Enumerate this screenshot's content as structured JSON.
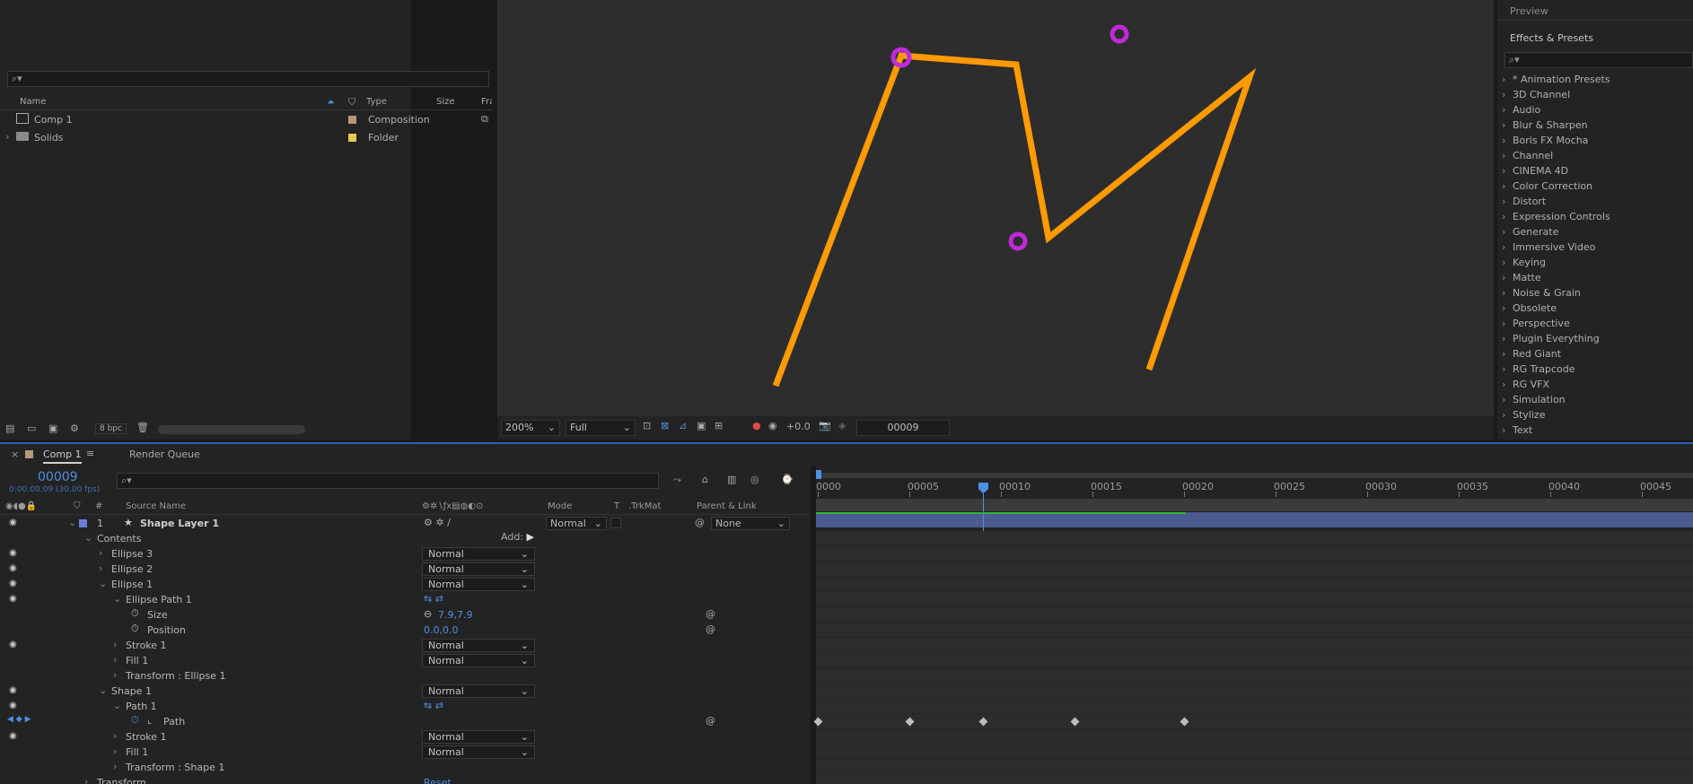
{
  "project": {
    "columns": {
      "name": "Name",
      "type": "Type",
      "size": "Size",
      "frame": "Fran"
    },
    "items": [
      {
        "name": "Comp 1",
        "type": "Composition",
        "color": "#b59a7a"
      },
      {
        "name": "Solids",
        "type": "Folder",
        "color": "#e6c84a"
      }
    ],
    "bpc": "8 bpc"
  },
  "viewer": {
    "zoom": "200%",
    "resolution": "Full",
    "exposure": "+0.0",
    "frame": "00009",
    "stroke_color": "#ff9a00",
    "point_color": "#c02ad8"
  },
  "effects": {
    "preview_label": "Preview",
    "title": "Effects & Presets",
    "items": [
      "* Animation Presets",
      "3D Channel",
      "Audio",
      "Blur & Sharpen",
      "Boris FX Mocha",
      "Channel",
      "CINEMA 4D",
      "Color Correction",
      "Distort",
      "Expression Controls",
      "Generate",
      "Immersive Video",
      "Keying",
      "Matte",
      "Noise & Grain",
      "Obsolete",
      "Perspective",
      "Plugin Everything",
      "Red Giant",
      "RG Trapcode",
      "RG VFX",
      "Simulation",
      "Stylize",
      "Text"
    ]
  },
  "timeline": {
    "tabs": [
      {
        "label": "Comp 1"
      },
      {
        "label": "Render Queue"
      }
    ],
    "timecode": "00009",
    "timecode_sub": "0:00:00:09 (30.00 fps)",
    "headers": {
      "num": "#",
      "source": "Source Name",
      "mode": "Mode",
      "t": "T",
      "trkmat": ".TrkMat",
      "parent": "Parent & Link"
    },
    "layer": {
      "num": "1",
      "name": "Shape Layer 1",
      "mode": "Normal",
      "parent": "None"
    },
    "add_label": "Add:",
    "rows": [
      {
        "label": "Contents",
        "indent": 0
      },
      {
        "label": "Ellipse 3",
        "indent": 1,
        "mode": "Normal",
        "eye": true
      },
      {
        "label": "Ellipse 2",
        "indent": 1,
        "mode": "Normal",
        "eye": true
      },
      {
        "label": "Ellipse 1",
        "indent": 1,
        "mode": "Normal",
        "eye": true,
        "open": true
      },
      {
        "label": "Ellipse Path 1",
        "indent": 2,
        "eye": true,
        "open": true
      },
      {
        "label": "Size",
        "indent": 3,
        "value": "7.9,7.9"
      },
      {
        "label": "Position",
        "indent": 3,
        "value": "0.0,0.0"
      },
      {
        "label": "Stroke 1",
        "indent": 2,
        "mode": "Normal",
        "eye": true
      },
      {
        "label": "Fill 1",
        "indent": 2,
        "mode": "Normal"
      },
      {
        "label": "Transform : Ellipse 1",
        "indent": 2
      },
      {
        "label": "Shape 1",
        "indent": 1,
        "mode": "Normal",
        "eye": true,
        "open": true
      },
      {
        "label": "Path 1",
        "indent": 2,
        "eye": true,
        "open": true
      },
      {
        "label": "Path",
        "indent": 3,
        "keyframed": true
      },
      {
        "label": "Stroke 1",
        "indent": 2,
        "mode": "Normal",
        "eye": true
      },
      {
        "label": "Fill 1",
        "indent": 2,
        "mode": "Normal"
      },
      {
        "label": "Transform : Shape 1",
        "indent": 2
      },
      {
        "label": "Transform",
        "indent": 0,
        "value": "Reset"
      }
    ],
    "ruler": [
      "0000",
      "00005",
      "00010",
      "00015",
      "00020",
      "00025",
      "00030",
      "00035",
      "00040",
      "00045"
    ],
    "playhead_frame": 9,
    "path_keyframes": [
      0,
      5,
      9,
      14,
      20
    ]
  }
}
